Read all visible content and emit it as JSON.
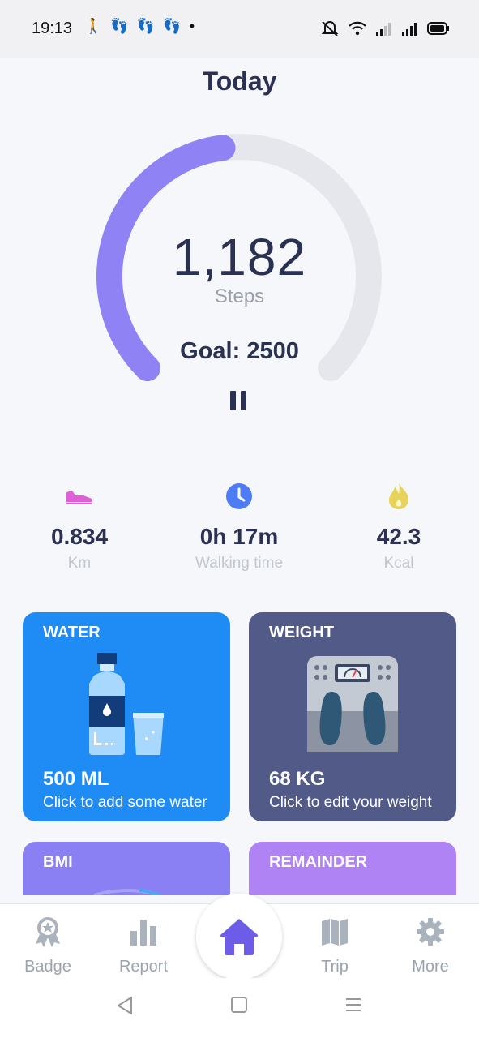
{
  "status_bar": {
    "time": "19:13",
    "left_icons": [
      "walking-icon",
      "footsteps-icon",
      "footsteps-icon",
      "footsteps-icon",
      "dot-icon"
    ],
    "right_icons": [
      "muted-bell-icon",
      "wifi-icon",
      "signal-icon",
      "signal-icon",
      "battery-icon"
    ]
  },
  "header": {
    "title": "Today"
  },
  "progress": {
    "steps": "1,182",
    "steps_label": "Steps",
    "goal_text": "Goal: 2500",
    "fraction": 0.4728,
    "colors": {
      "fill": "#8e82f5",
      "track": "#e6e7ec"
    }
  },
  "stats": [
    {
      "icon": "shoe-icon",
      "value": "0.834",
      "label": "Km",
      "color": "#e05ed8"
    },
    {
      "icon": "clock-icon",
      "value": "0h 17m",
      "label": "Walking time",
      "color": "#4e7cf4"
    },
    {
      "icon": "flame-icon",
      "value": "42.3",
      "label": "Kcal",
      "color": "#e8d35a"
    }
  ],
  "cards": {
    "water": {
      "title": "WATER",
      "value": "500 ML",
      "subtitle": "Click to add some water",
      "color": "#1f8bf5"
    },
    "weight": {
      "title": "WEIGHT",
      "value": "68 KG",
      "subtitle": "Click to edit your weight",
      "color": "#525a87"
    },
    "bmi": {
      "title": "BMI",
      "color": "#8b7ff4"
    },
    "remainder": {
      "title": "REMAINDER",
      "color": "#b083f5"
    }
  },
  "tab_bar": {
    "tabs": [
      {
        "icon": "badge-icon",
        "label": "Badge"
      },
      {
        "icon": "report-icon",
        "label": "Report"
      },
      {
        "icon": "home-icon",
        "label": ""
      },
      {
        "icon": "trip-icon",
        "label": "Trip"
      },
      {
        "icon": "more-icon",
        "label": "More"
      }
    ],
    "active_color": "#6c5ce7"
  },
  "system_nav": [
    "back-icon",
    "home-square-icon",
    "menu-icon"
  ]
}
